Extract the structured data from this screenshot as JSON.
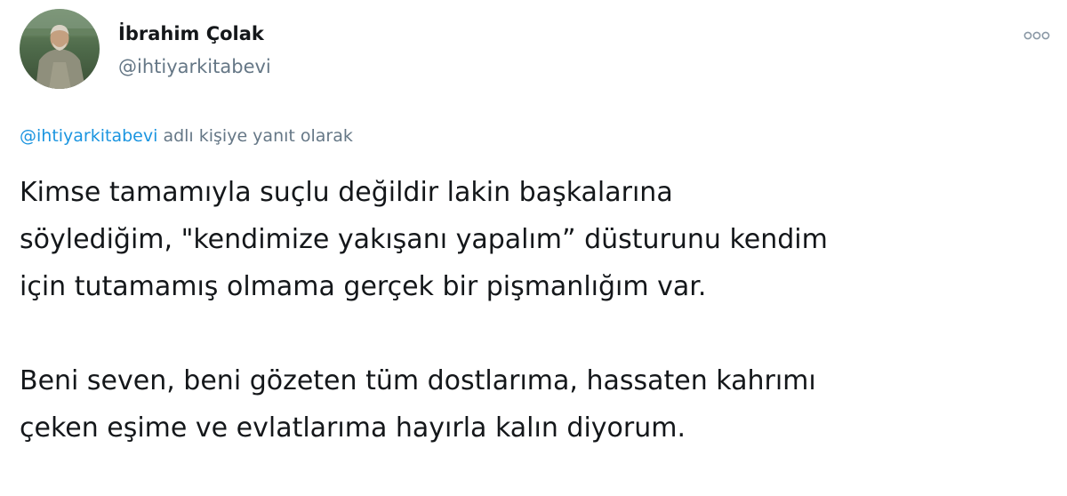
{
  "author": {
    "name": "İbrahim Çolak",
    "handle": "@ihtiyarkitabevi"
  },
  "reply_context": {
    "mention": "@ihtiyarkitabevi",
    "suffix": " adlı kişiye yanıt olarak"
  },
  "tweet": {
    "paragraphs": [
      "Kimse tamamıyla suçlu değildir lakin başkalarına\nsöylediğim,  \"kendimize yakışanı yapalım” düsturunu kendim\niçin tutamamış olmama gerçek bir pişmanlığım var.",
      "Beni seven, beni gözeten tüm dostlarıma, hassaten kahrımı\nçeken eşime ve evlatlarıma hayırla kalın diyorum."
    ]
  },
  "icons": {
    "more": "more-options-icon",
    "avatar": "profile-photo"
  },
  "colors": {
    "text": "#14171a",
    "secondary": "#657786",
    "link": "#1b95e0",
    "background": "#ffffff"
  }
}
